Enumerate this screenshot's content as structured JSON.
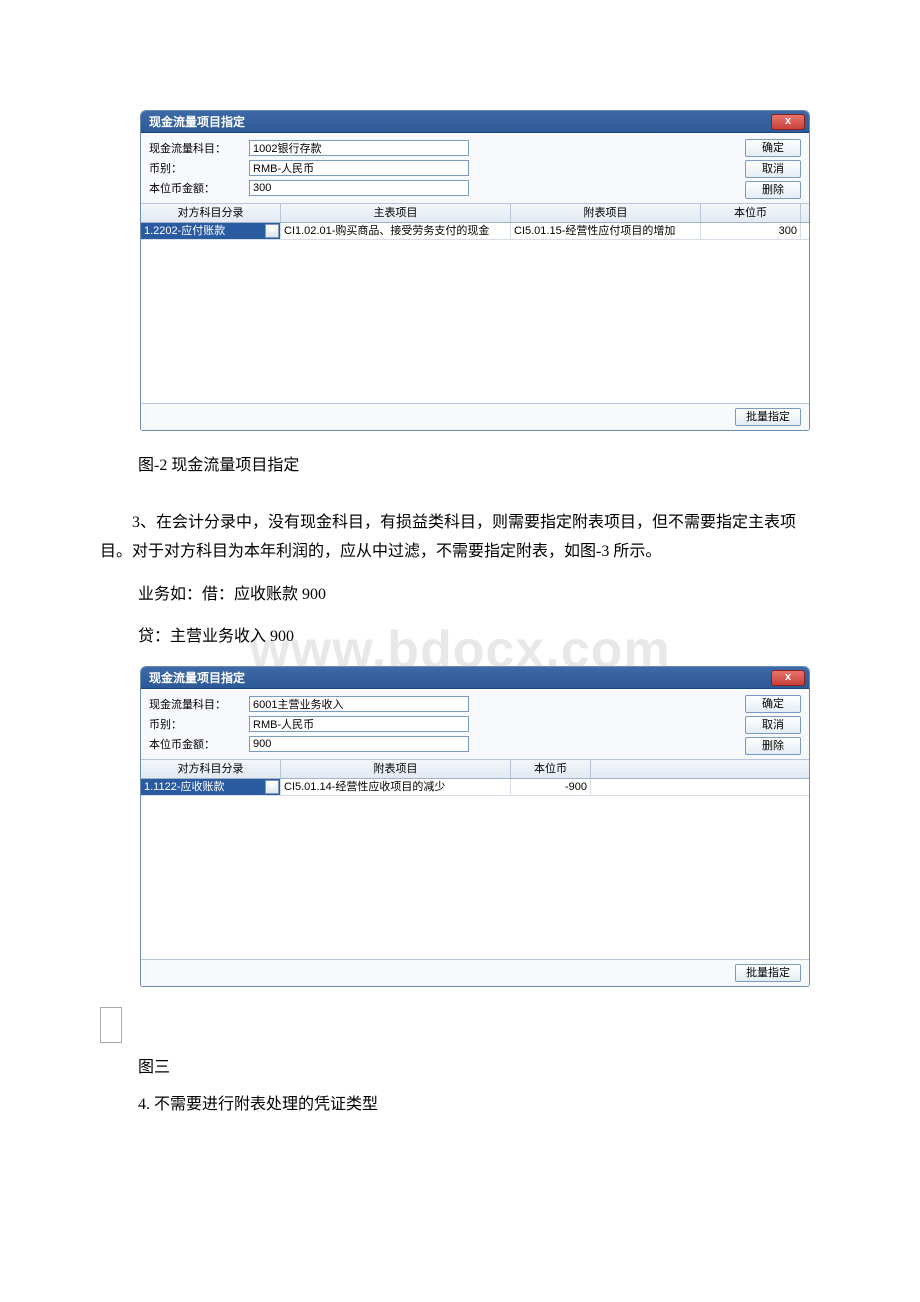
{
  "watermark": "www.bdocx.com",
  "dialog1": {
    "title": "现金流量项目指定",
    "close_x": "x",
    "labels": {
      "subject": "现金流量科目：",
      "currency": "币别：",
      "amount": "本位币金额："
    },
    "values": {
      "subject": "1002银行存款",
      "currency": "RMB-人民币",
      "amount": "300"
    },
    "buttons": {
      "ok": "确定",
      "cancel": "取消",
      "delete": "删除",
      "batch": "批量指定"
    },
    "headers": {
      "c1": "对方科目分录",
      "c2": "主表项目",
      "c3": "附表项目",
      "c4": "本位币"
    },
    "row": {
      "c1": "1.2202-应付账款",
      "c2": "CI1.02.01-购买商品、接受劳务支付的现金",
      "c3": "CI5.01.15-经营性应付项目的增加",
      "c4": "300"
    }
  },
  "caption1": "图-2 现金流量项目指定",
  "para1": "3、在会计分录中，没有现金科目，有损益类科目，则需要指定附表项目，但不需要指定主表项目。对于对方科目为本年利润的，应从中过滤，不需要指定附表，如图-3 所示。",
  "para2": "业务如：借：应收账款 900",
  "para3": "贷：主营业务收入 900",
  "dialog2": {
    "title": "现金流量项目指定",
    "close_x": "x",
    "labels": {
      "subject": "现金流量科目：",
      "currency": "币别：",
      "amount": "本位币金额："
    },
    "values": {
      "subject": "6001主营业务收入",
      "currency": "RMB-人民币",
      "amount": "900"
    },
    "buttons": {
      "ok": "确定",
      "cancel": "取消",
      "delete": "删除",
      "batch": "批量指定"
    },
    "headers": {
      "c1": "对方科目分录",
      "c2": "附表项目",
      "c3": "本位币"
    },
    "row": {
      "c1": "1.1122-应收账款",
      "c2": "CI5.01.14-经营性应收项目的减少",
      "c3": "-900"
    }
  },
  "caption2": "图三",
  "para4": "4. 不需要进行附表处理的凭证类型"
}
